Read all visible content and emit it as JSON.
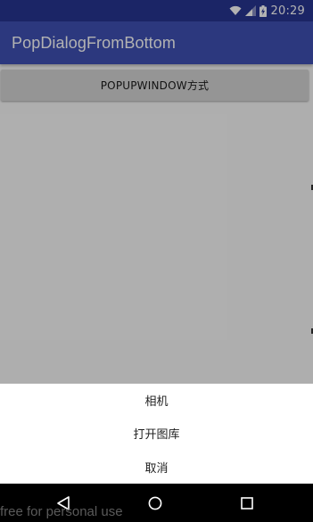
{
  "status_bar": {
    "time": "20:29",
    "icons": [
      "wifi-icon",
      "signal-icon",
      "battery-charging-icon"
    ]
  },
  "app_bar": {
    "title": "PopDialogFromBottom"
  },
  "content": {
    "popup_button_label": "POPUPWINDOW方式"
  },
  "bottom_sheet": {
    "items": [
      {
        "label": "相机"
      },
      {
        "label": "打开图库"
      },
      {
        "label": "取消"
      }
    ]
  },
  "nav_bar": {
    "icons": [
      "back-icon",
      "home-icon",
      "recents-icon"
    ]
  },
  "watermark": "free for personal use",
  "colors": {
    "status_bar": "#283593",
    "app_bar": "#3f51b5",
    "button": "#d6d6d6",
    "sheet": "#ffffff",
    "nav_bar": "#000000"
  }
}
